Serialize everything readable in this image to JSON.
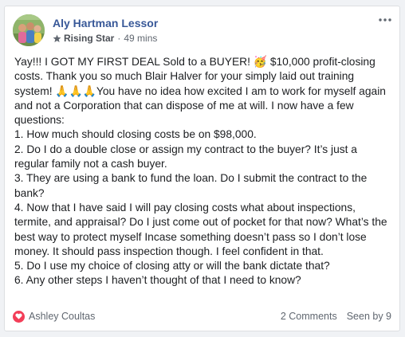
{
  "post": {
    "author": "Aly Hartman Lessor",
    "badge": "Rising Star",
    "separator": "·",
    "time": "49 mins",
    "text_intro_1": "Yay!!! I GOT MY FIRST DEAL Sold to a BUYER! ",
    "emoji_party": "🥳",
    "text_intro_2": " $10,000 profit-closing costs. Thank you so much Blair Halver for your simply laid out training system! ",
    "emoji_pray": "🙏🙏🙏",
    "text_intro_3": "You have no idea how excited I am to work for myself again and not a Corporation that can dispose of me at will. I now have a few questions:",
    "questions": [
      "1. How much should closing costs be on $98,000.",
      "2. Do I do a double close or assign my contract to the buyer? It’s just a regular family not a cash buyer.",
      "3. They are using a bank to fund the loan. Do I submit the contract to the bank?",
      "4. Now that I have said I will pay closing costs what about inspections, termite, and appraisal? Do I just come out of pocket for that now? What’s the best way to protect myself Incase something doesn’t pass so I don’t lose money. It should pass inspection though. I feel confident in that.",
      "5. Do I use my choice of closing atty or will the bank dictate that?",
      "6. Any other steps I haven’t thought of that I need to know?"
    ]
  },
  "footer": {
    "reaction_name": "Ashley Coultas",
    "comments": "2 Comments",
    "seen": "Seen by 9"
  },
  "icons": {
    "badge": "star-badge-icon",
    "reaction": "heart-icon",
    "more": "more-options-icon"
  },
  "colors": {
    "author": "#385898",
    "reaction": "#f33e58",
    "meta": "#606770"
  }
}
